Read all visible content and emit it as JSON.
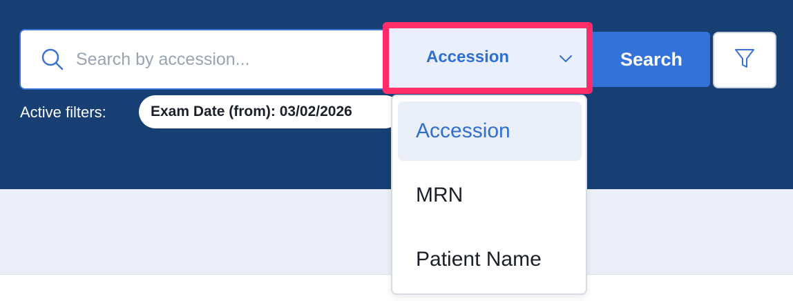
{
  "search": {
    "placeholder": "Search by accession...",
    "value": "",
    "field_selected": "Accession",
    "button_label": "Search"
  },
  "filters": {
    "label": "Active filters:",
    "chips": [
      {
        "text": "Exam Date (from): 03/02/2026"
      }
    ]
  },
  "dropdown": {
    "options": [
      {
        "label": "Accession",
        "selected": true
      },
      {
        "label": "MRN",
        "selected": false
      },
      {
        "label": "Patient Name",
        "selected": false
      }
    ]
  },
  "colors": {
    "header_bg": "#183f73",
    "accent": "#3372d8",
    "highlight_border": "#ff2e6a",
    "content_bg": "#eceff7"
  },
  "icons": {
    "search": "search-icon",
    "chevron": "chevron-down-icon",
    "filter": "filter-icon"
  }
}
